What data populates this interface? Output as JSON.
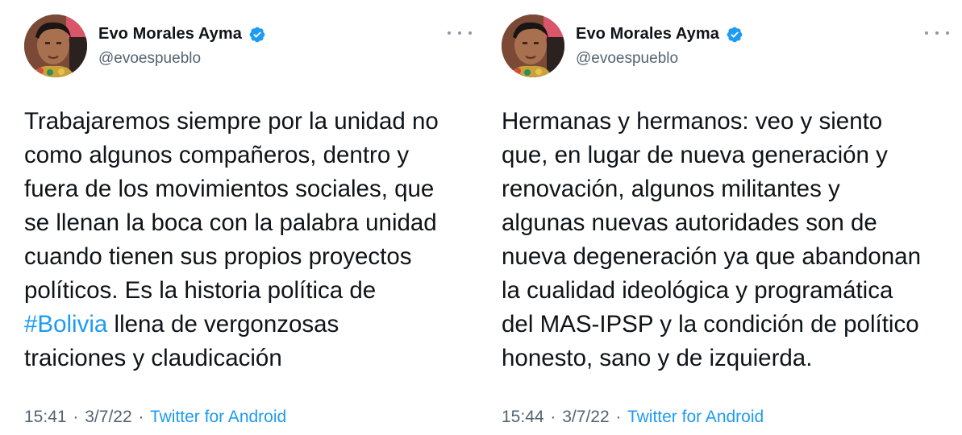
{
  "tweets": [
    {
      "author": {
        "name": "Evo Morales Ayma",
        "handle": "@evoespueblo",
        "verified": true
      },
      "text_before": "Trabajaremos siempre por la unidad no\ncomo algunos compañeros, dentro y\nfuera de los movimientos sociales, que\nse llenan la boca con la palabra unidad\ncuando tienen sus propios proyectos\npolíticos. Es la historia política de\n",
      "hashtag": "#Bolivia",
      "text_after": " llena de vergonzosas\ntraiciones y claudicación",
      "time": "15:41",
      "date": "3/7/22",
      "separator": "·",
      "source": "Twitter for Android"
    },
    {
      "author": {
        "name": "Evo Morales Ayma",
        "handle": "@evoespueblo",
        "verified": true
      },
      "text": "Hermanas y hermanos: veo y siento\nque, en lugar de nueva generación y\nrenovación, algunos militantes y\nalgunas nuevas autoridades son de\nnueva degeneración ya que abandonan\nla cualidad ideológica y programática\ndel MAS-IPSP y la condición de político\nhonesto, sano y de izquierda.",
      "time": "15:44",
      "date": "3/7/22",
      "separator": "·",
      "source": "Twitter for Android"
    }
  ],
  "icons": {
    "verified": "verified-badge-icon",
    "more": "more-options-icon"
  },
  "colors": {
    "link": "#1d9bf0",
    "secondary": "#536471",
    "text": "#0f1419"
  }
}
